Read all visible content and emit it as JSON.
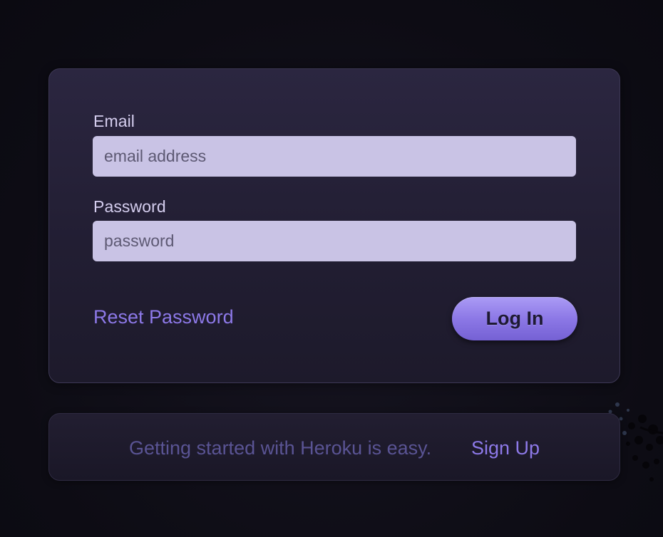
{
  "login_form": {
    "email_label": "Email",
    "email_placeholder": "email address",
    "email_value": "",
    "password_label": "Password",
    "password_placeholder": "password",
    "password_value": "",
    "reset_link": "Reset Password",
    "login_button": "Log In"
  },
  "signup_panel": {
    "text": "Getting started with Heroku is easy.",
    "link": "Sign Up"
  },
  "colors": {
    "background": "#0f0e17",
    "card": "#2b2640",
    "input": "#c9c3e5",
    "accent": "#8d79e8",
    "muted_text": "#5a5494"
  }
}
